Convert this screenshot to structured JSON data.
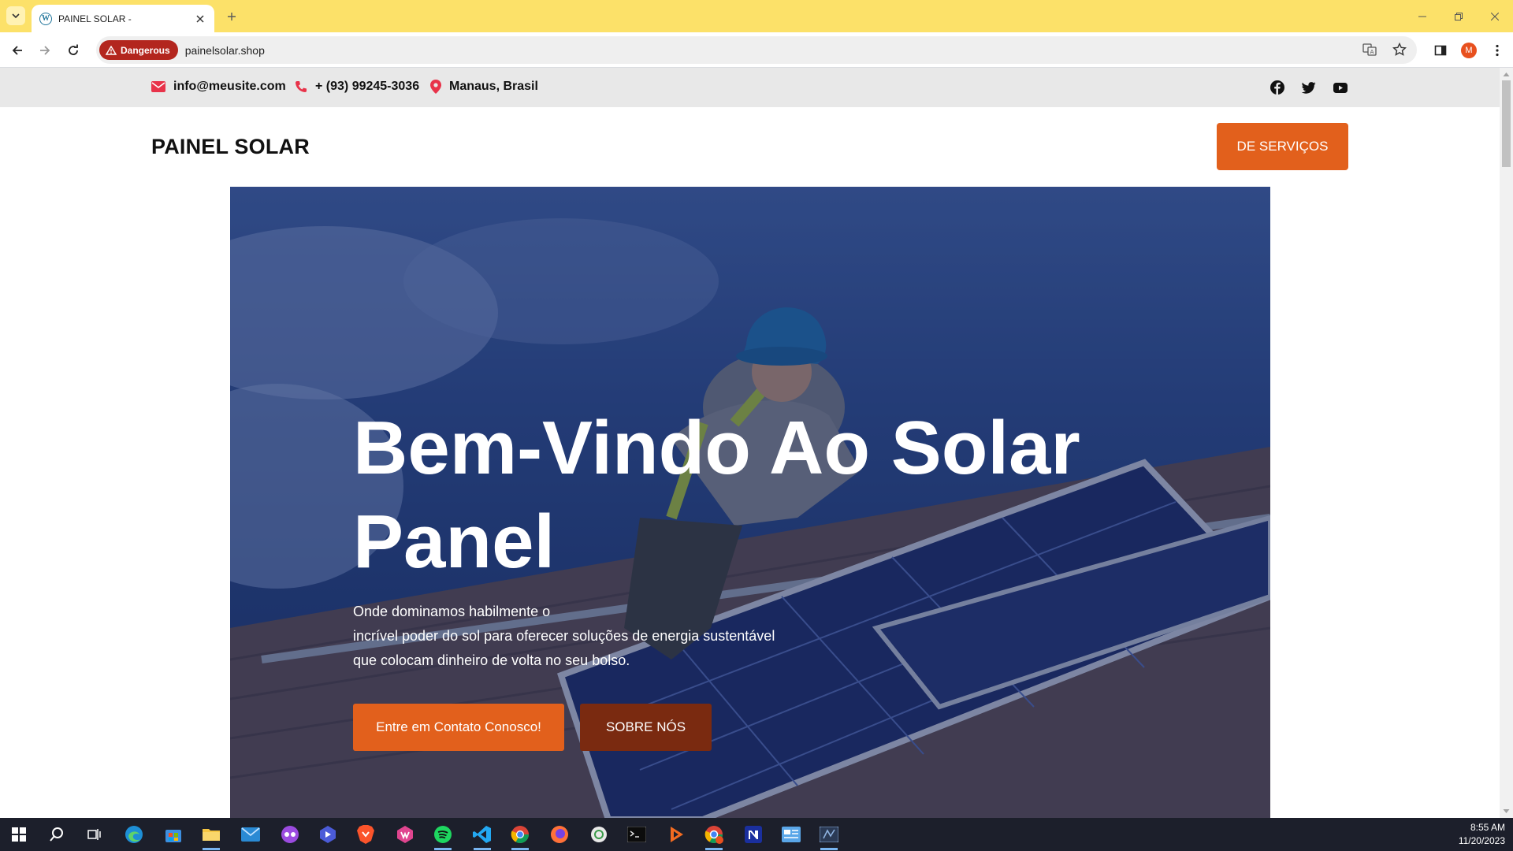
{
  "browser": {
    "tab_title": "PAINEL SOLAR -",
    "tab_favicon": "W",
    "security_label": "Dangerous",
    "url": "painelsolar.shop",
    "profile_initial": "M"
  },
  "topbar": {
    "email": "info@meusite.com",
    "phone": "+ (93) 99245-3036",
    "location": "Manaus, Brasil",
    "social": [
      "facebook-icon",
      "twitter-icon",
      "youtube-icon"
    ]
  },
  "header": {
    "brand": "PAINEL SOLAR",
    "cta_label": "DE SERVIÇOS"
  },
  "hero": {
    "title_line1": "Bem-Vindo Ao Solar",
    "title_line2": "Panel",
    "text_line1": "Onde dominamos habilmente o",
    "text_line2": "incrível poder do sol para oferecer soluções de energia sustentável",
    "text_line3": "que colocam dinheiro de volta no seu bolso.",
    "primary_button": "Entre em Contato Conosco!",
    "secondary_button": "SOBRE NÓS"
  },
  "colors": {
    "accent": "#e2601c",
    "accent_dark": "#7a2a10",
    "tabstrip": "#fce169",
    "danger": "#b3261e"
  },
  "taskbar": {
    "apps": [
      "windows-start-icon",
      "search-icon",
      "task-view-icon",
      "edge-icon",
      "store-icon",
      "file-explorer-icon",
      "mail-icon",
      "app-icon-1",
      "app-icon-2",
      "brave-icon",
      "app-icon-3",
      "spotify-icon",
      "vscode-icon",
      "chrome-icon",
      "firefox-icon",
      "app-icon-4",
      "terminal-icon",
      "app-icon-5",
      "chrome-profile-icon",
      "notion-icon",
      "app-icon-6",
      "app-icon-7"
    ],
    "time": "8:55 AM",
    "date": "11/20/2023"
  }
}
